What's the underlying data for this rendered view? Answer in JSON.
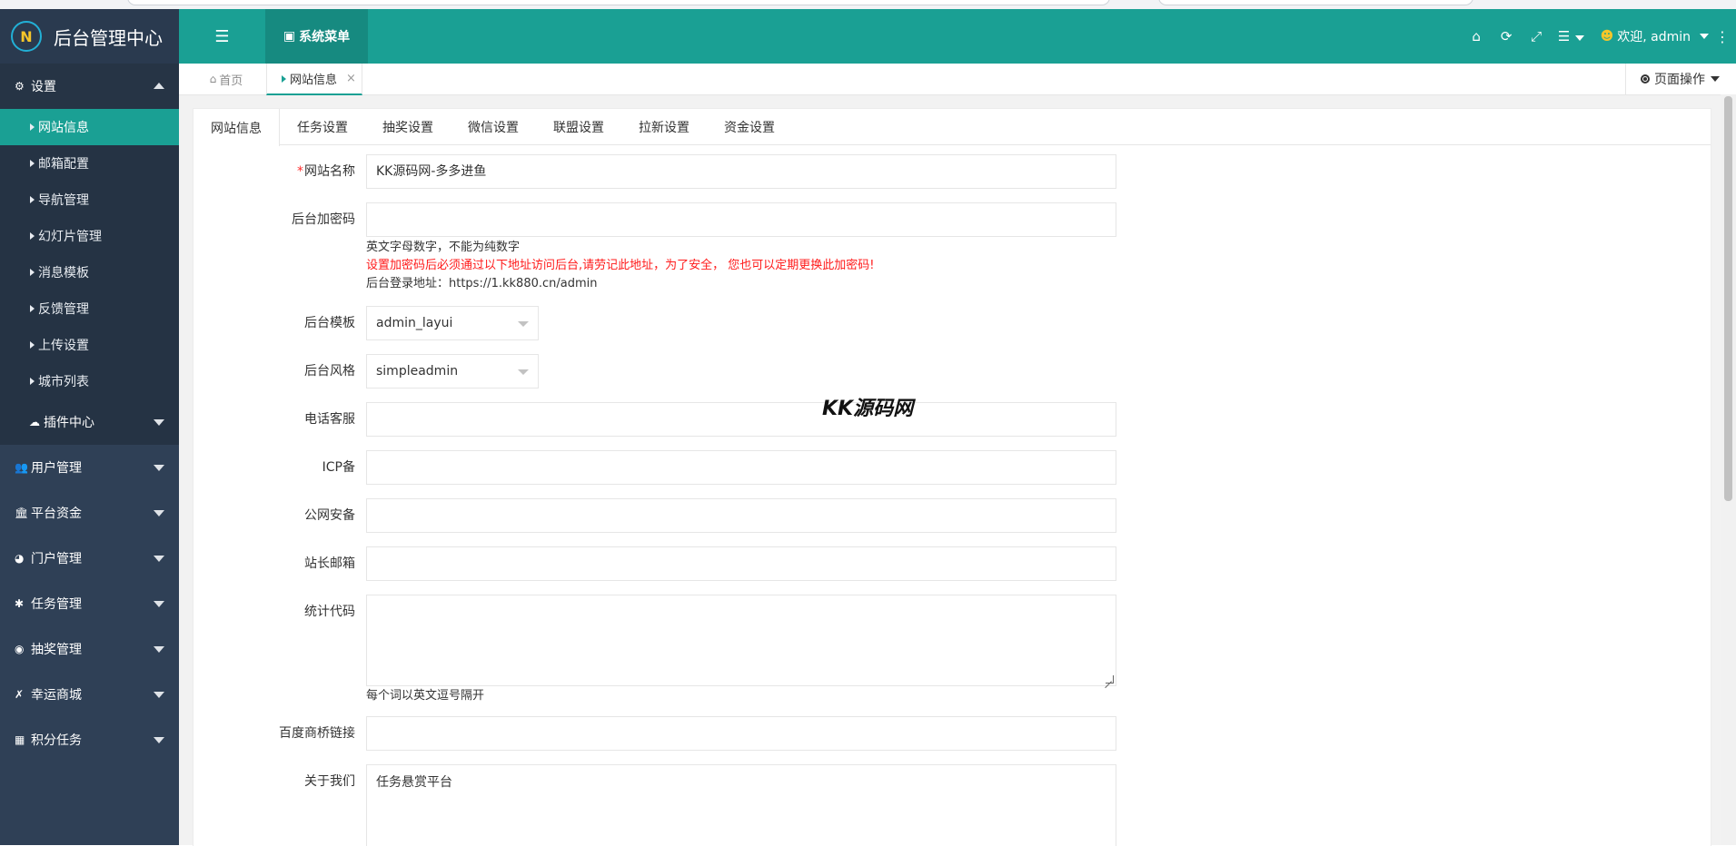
{
  "app": {
    "title": "后台管理中心",
    "logo_text": "N",
    "colors": {
      "header": "#1aa094",
      "sidebar": "#2f4056",
      "active": "#1aa094",
      "required": "#ff2b2b"
    }
  },
  "header": {
    "menu_toggle_icon": "list-icon",
    "sys_menu_label": "系统菜单",
    "right_icons": [
      "home-icon",
      "refresh-icon",
      "fullscreen-icon",
      "menu-icon"
    ],
    "welcome": "欢迎, admin"
  },
  "sidebar": {
    "settings_label": "设置",
    "settings_items": [
      {
        "label": "网站信息",
        "active": true
      },
      {
        "label": "邮箱配置"
      },
      {
        "label": "导航管理"
      },
      {
        "label": "幻灯片管理"
      },
      {
        "label": "消息模板"
      },
      {
        "label": "反馈管理"
      },
      {
        "label": "上传设置"
      },
      {
        "label": "城市列表"
      }
    ],
    "plugin_label": "插件中心",
    "groups": [
      {
        "label": "用户管理",
        "icon": "users-icon"
      },
      {
        "label": "平台资金",
        "icon": "bank-icon"
      },
      {
        "label": "门户管理",
        "icon": "globe-icon"
      },
      {
        "label": "任务管理",
        "icon": "bug-icon"
      },
      {
        "label": "抽奖管理",
        "icon": "compass-icon"
      },
      {
        "label": "幸运商城",
        "icon": "shop-icon"
      },
      {
        "label": "积分任务",
        "icon": "grid-icon"
      }
    ]
  },
  "pagetabs": {
    "home": "首页",
    "current": "网站信息",
    "close": "×",
    "page_ops": "页面操作"
  },
  "form_tabs": [
    "网站信息",
    "任务设置",
    "抽奖设置",
    "微信设置",
    "联盟设置",
    "拉新设置",
    "资金设置"
  ],
  "form": {
    "site_name_label": "网站名称",
    "site_name_required": "*",
    "site_name_value": "KK源码网-多多进鱼",
    "admin_key_label": "后台加密码",
    "admin_key_value": "",
    "admin_key_hint1": "英文字母数字，不能为纯数字",
    "admin_key_hint2": "设置加密码后必须通过以下地址访问后台,请劳记此地址，为了安全， 您也可以定期更换此加密码!",
    "admin_key_hint3": "后台登录地址：https://1.kk880.cn/admin",
    "template_label": "后台模板",
    "template_value": "admin_layui",
    "style_label": "后台风格",
    "style_value": "simpleadmin",
    "phone_label": "电话客服",
    "phone_value": "",
    "icp_label": "ICP备",
    "icp_value": "",
    "police_label": "公网安备",
    "police_value": "",
    "email_label": "站长邮箱",
    "email_value": "",
    "stats_label": "统计代码",
    "stats_value": "",
    "stats_hint": "每个词以英文逗号隔开",
    "baidu_label": "百度商桥链接",
    "baidu_value": "",
    "about_label": "关于我们",
    "about_value": "任务悬赏平台"
  },
  "watermark": "KK源码网"
}
